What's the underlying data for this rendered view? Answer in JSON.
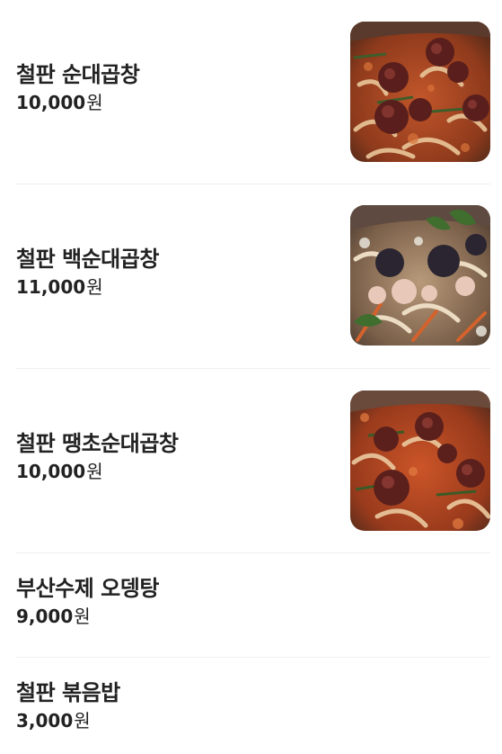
{
  "menu": {
    "items": [
      {
        "name": "철판 순대곱창",
        "price": "10,000",
        "unit": "원",
        "thumbnail": "sundae-gopchang-photo"
      },
      {
        "name": "철판 백순대곱창",
        "price": "11,000",
        "unit": "원",
        "thumbnail": "baek-sundae-gopchang-photo"
      },
      {
        "name": "철판 땡초순대곱창",
        "price": "10,000",
        "unit": "원",
        "thumbnail": "ttaengcho-sundae-gopchang-photo"
      },
      {
        "name": "부산수제 오뎅탕",
        "price": "9,000",
        "unit": "원"
      },
      {
        "name": "철판 볶음밥",
        "price": "3,000",
        "unit": "원"
      }
    ]
  },
  "colors": {
    "text": "#222222",
    "divider": "#efefef",
    "background": "#ffffff"
  }
}
